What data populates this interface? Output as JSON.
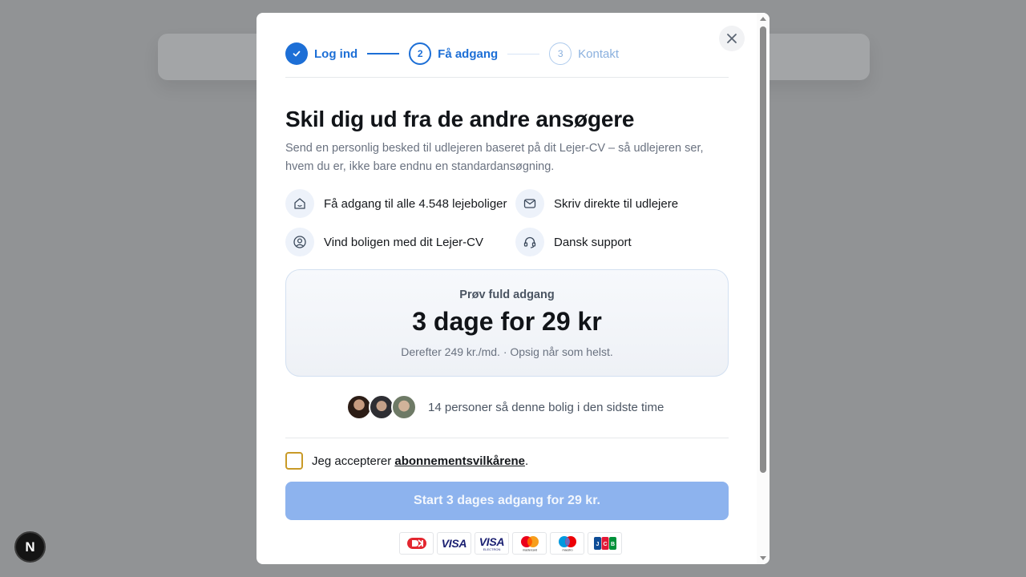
{
  "background_badge": {
    "letter": "N"
  },
  "stepper": {
    "steps": [
      {
        "number": "",
        "label": "Log ind",
        "state": "done"
      },
      {
        "number": "2",
        "label": "Få adgang",
        "state": "active"
      },
      {
        "number": "3",
        "label": "Kontakt",
        "state": "upcoming"
      }
    ]
  },
  "modal": {
    "title": "Skil dig ud fra de andre ansøgere",
    "subtitle": "Send en personlig besked til udlejeren baseret på dit Lejer-CV – så udlejeren ser, hvem du er, ikke bare endnu en standardansøgning.",
    "features": [
      {
        "icon": "house-icon",
        "label": "Få adgang til alle 4.548 lejeboliger"
      },
      {
        "icon": "mail-icon",
        "label": "Skriv direkte til udlejere"
      },
      {
        "icon": "user-icon",
        "label": "Vind boligen med dit Lejer-CV"
      },
      {
        "icon": "headset-icon",
        "label": "Dansk support"
      }
    ],
    "offer": {
      "kicker": "Prøv fuld adgang",
      "price": "3 dage for 29 kr",
      "note": "Derefter 249 kr./md. · Opsig når som helst."
    },
    "social_proof": "14 personer så denne bolig i den sidste time",
    "terms": {
      "prefix": "Jeg accepterer ",
      "link": "abonnementsvilkårene",
      "suffix": ".",
      "checked": false
    },
    "cta_label": "Start 3 dages adgang for 29 kr.",
    "payment_methods": [
      "Dankort",
      "VISA",
      "VISA ELECTRON",
      "mastercard",
      "maestro",
      "JCB"
    ]
  },
  "colors": {
    "primary": "#1d6fd6",
    "cta_disabled": "#8db3ee",
    "overlay": "#919395"
  }
}
